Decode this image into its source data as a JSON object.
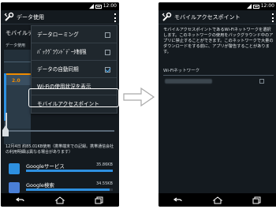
{
  "left": {
    "status_time": "12:00",
    "title": "データ使用",
    "setting_label": "モバイルデー",
    "sub_text": "データ使用",
    "limit_value": "2.0",
    "menu_items": [
      {
        "label": "データローミング",
        "checked": false
      },
      {
        "label": "ﾊﾞｯｸｸﾞﾗｳﾝﾄﾞﾃﾞｰﾀ制限",
        "checked": false
      },
      {
        "label": "データの自動同期",
        "checked": true
      },
      {
        "label": "Wi-Fiの使用状況を表示",
        "checked": null
      },
      {
        "label": "モバイルアクセスポイント",
        "checked": null
      }
    ],
    "period_text": "12月4日 約85.01KB使用（携帯端末での記録。携帯通信会社の利用明細は異なる場合があります）",
    "apps": [
      {
        "name": "Googleサービス",
        "size": "35.86KB",
        "usage": 1.0,
        "icon_color": "#2e90e0"
      },
      {
        "name": "Google検索",
        "size": "34.55KB",
        "usage": 0.96,
        "icon_color": "#4a7fd6"
      }
    ]
  },
  "right": {
    "status_time": "12:00",
    "title": "モバイルアクセスポイント",
    "description": "モバイルアクセスポイントであるWi-Fiネットワークを選択します。このネットワークの使用をバックグラウンド中のアプリに禁止することができます。このネットワークで大量のダウンロードをする前に、アプリが警告することがあります。",
    "section_header": "Wi-Fiネットワーク"
  }
}
